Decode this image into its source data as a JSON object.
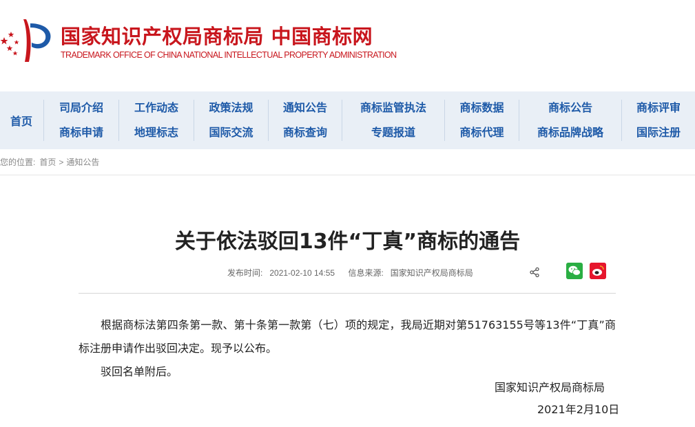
{
  "header": {
    "title": "国家知识产权局商标局 中国商标网",
    "subtitle": "TRADEMARK OFFICE OF CHINA NATIONAL INTELLECTUAL PROPERTY ADMINISTRATION"
  },
  "nav": {
    "home": "首页",
    "columns": [
      [
        "司局介绍",
        "商标申请"
      ],
      [
        "工作动态",
        "地理标志"
      ],
      [
        "政策法规",
        "国际交流"
      ],
      [
        "通知公告",
        "商标查询"
      ],
      [
        "商标监管执法",
        "专题报道"
      ],
      [
        "商标数据",
        "商标代理"
      ],
      [
        "商标公告",
        "商标品牌战略"
      ],
      [
        "商标评审",
        "国际注册"
      ]
    ]
  },
  "breadcrumb": {
    "prefix": "您的位置:",
    "home": "首页",
    "separator": ">",
    "current": "通知公告"
  },
  "article": {
    "title": "关于依法驳回13件“丁真”商标的通告",
    "publish_label": "发布时间:",
    "publish_time": "2021-02-10 14:55",
    "source_label": "信息来源:",
    "source": "国家知识产权局商标局",
    "paragraphs": [
      "根据商标法第四条第一款、第十条第一款第（七）项的规定，我局近期对第51763155号等13件“丁真”商标注册申请作出驳回决定。现予以公布。",
      "驳回名单附后。"
    ],
    "signature_org": "国家知识产权局商标局",
    "signature_date": "2021年2月10日"
  },
  "icons": {
    "share": "share-icon",
    "wechat": "wechat-icon",
    "weibo": "weibo-icon"
  },
  "colors": {
    "brand_red": "#c8161d",
    "nav_blue": "#1e5aa8",
    "nav_bg": "#e9eff6"
  }
}
